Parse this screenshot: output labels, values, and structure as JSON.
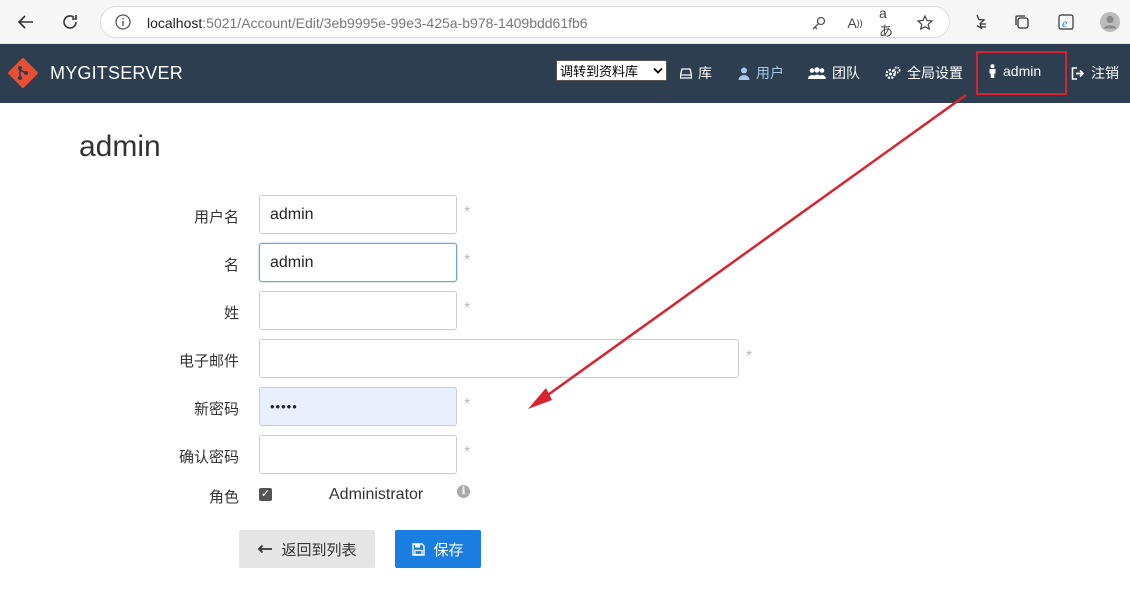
{
  "browser": {
    "url_host": "localhost",
    "url_rest": ":5021/Account/Edit/3eb9995e-99e3-425a-b978-1409bdd61fb6"
  },
  "navbar": {
    "brand": "MYGITSERVER",
    "select_value": "调转到资料库",
    "items": {
      "repos": "库",
      "users": "用户",
      "teams": "团队",
      "settings": "全局设置",
      "current_user": "admin",
      "logout": "注销"
    }
  },
  "page": {
    "title": "admin"
  },
  "form": {
    "username": {
      "label": "用户名",
      "value": "admin"
    },
    "given_name": {
      "label": "名",
      "value": "admin"
    },
    "surname": {
      "label": "姓",
      "value": ""
    },
    "email": {
      "label": "电子邮件",
      "value": ""
    },
    "new_password": {
      "label": "新密码",
      "value": "•••••"
    },
    "confirm_password": {
      "label": "确认密码",
      "value": ""
    },
    "role": {
      "label": "角色",
      "option": "Administrator",
      "checked": true
    },
    "required_mark": "*"
  },
  "buttons": {
    "back": "返回到列表",
    "save": "保存"
  },
  "colors": {
    "navbar_bg": "#2c3e50",
    "primary": "#1a7ee0",
    "annotation": "#d9232e"
  }
}
